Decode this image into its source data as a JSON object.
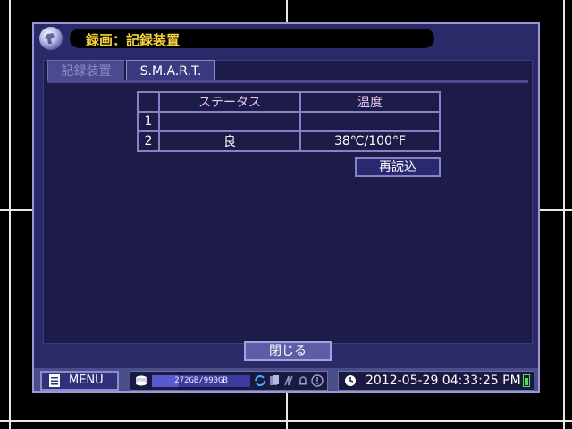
{
  "title": "録画：記録装置",
  "tabs": [
    {
      "label": "記録装置",
      "active": false
    },
    {
      "label": "S.M.A.R.T.",
      "active": true
    }
  ],
  "table": {
    "headers": [
      "",
      "ステータス",
      "温度"
    ],
    "rows": [
      {
        "index": "1",
        "status": "",
        "temperature": ""
      },
      {
        "index": "2",
        "status": "良",
        "temperature": "38℃/100°F"
      }
    ]
  },
  "buttons": {
    "reload": "再読込",
    "close": "閉じる",
    "menu": "MENU"
  },
  "statusbar": {
    "storage_text": "272GB/990GB",
    "storage_used_fraction": 0.27,
    "datetime": "2012-05-29 04:33:25 PM"
  },
  "icons": [
    "globe-logo-icon",
    "menu-list-icon",
    "disk-icon",
    "refresh-icon",
    "copy-icon",
    "network-icon",
    "alarm-bell-icon",
    "warning-icon",
    "clock-icon",
    "battery-icon"
  ],
  "colors": {
    "window_bg": "#2b2a68",
    "title_text": "#f5d23a",
    "accent_border": "#8583c8"
  }
}
